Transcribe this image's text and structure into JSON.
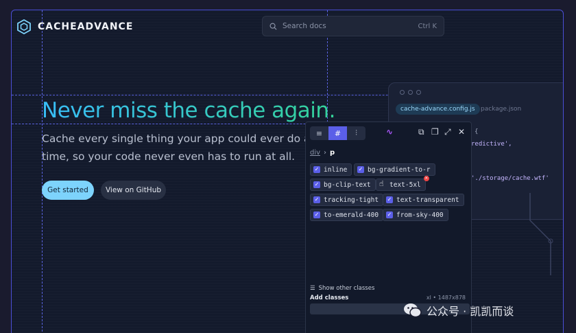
{
  "brand": {
    "name": "CACHEADVANCE"
  },
  "search": {
    "placeholder": "Search docs",
    "shortcut": "Ctrl K"
  },
  "hero": {
    "title": "Never miss the cache again.",
    "subtitle_line1": "Cache every single thing your app could ever do ah",
    "subtitle_line2": "time, so your code never even has to run at all.",
    "primary_button": "Get started",
    "secondary_button": "View on GitHub"
  },
  "code_window": {
    "tabs": [
      "cache-advance.config.js",
      "package.json"
    ],
    "lines": [
      "{",
      "redictive',",
      "'./storage/cache.wtf'"
    ]
  },
  "devtools": {
    "toolbar_modes": [
      "list-icon",
      "hash-icon",
      "sliders-icon"
    ],
    "active_mode": "hash-icon",
    "breadcrumb": {
      "parent": "div",
      "current": "p"
    },
    "classes": [
      {
        "name": "inline",
        "checked": true
      },
      {
        "name": "bg-gradient-to-r",
        "checked": true
      },
      {
        "name": "bg-clip-text",
        "checked": true
      },
      {
        "name": "text-5xl",
        "checked": false
      },
      {
        "name": "tracking-tight",
        "checked": true
      },
      {
        "name": "text-transparent",
        "checked": true
      },
      {
        "name": "to-emerald-400",
        "checked": true
      },
      {
        "name": "from-sky-400",
        "checked": true
      }
    ],
    "show_other": "Show other classes",
    "add_classes": "Add classes",
    "viewport": "xl • 1487x878"
  },
  "watermark": {
    "text": "公众号 · 凯凯而谈"
  },
  "colors": {
    "accent": "#5b5fe8",
    "guide": "#5a63e0",
    "sky": "#38bdf8",
    "emerald": "#34d399"
  }
}
